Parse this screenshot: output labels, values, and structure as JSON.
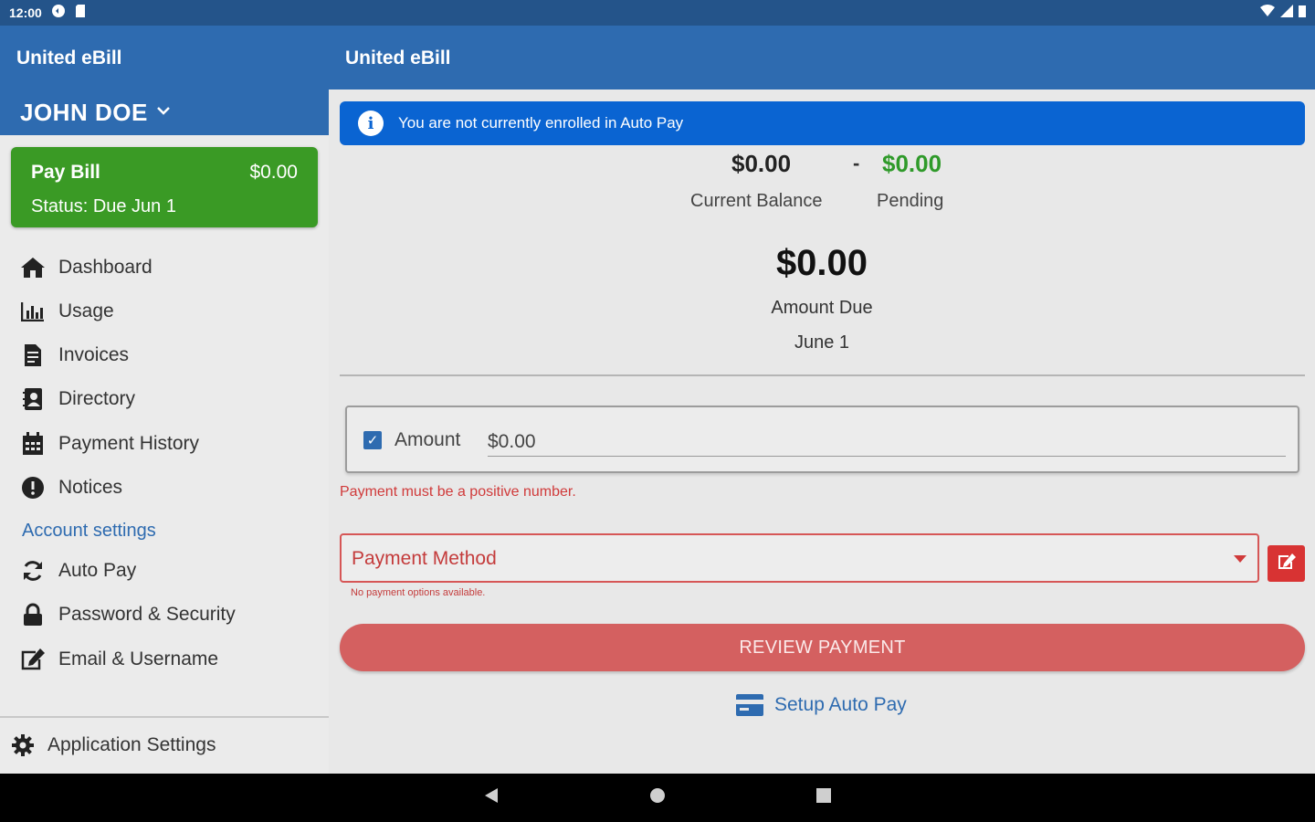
{
  "status_bar": {
    "time": "12:00"
  },
  "app_bar": {
    "title_left": "United eBill",
    "title_main": "United eBill"
  },
  "sidebar": {
    "user_name": "JOHN DOE",
    "pay_bill": {
      "title": "Pay Bill",
      "amount": "$0.00",
      "status": "Status: Due Jun 1"
    },
    "items": [
      {
        "label": "Dashboard",
        "icon": "home-icon"
      },
      {
        "label": "Usage",
        "icon": "bar-chart-icon"
      },
      {
        "label": "Invoices",
        "icon": "invoice-icon"
      },
      {
        "label": "Directory",
        "icon": "contact-book-icon"
      },
      {
        "label": "Payment History",
        "icon": "calendar-icon"
      },
      {
        "label": "Notices",
        "icon": "alert-circle-icon"
      }
    ],
    "account_settings_label": "Account settings",
    "account_items": [
      {
        "label": "Auto Pay",
        "icon": "sync-icon"
      },
      {
        "label": "Password & Security",
        "icon": "lock-icon"
      },
      {
        "label": "Email & Username",
        "icon": "edit-icon"
      }
    ],
    "app_settings_label": "Application Settings"
  },
  "main": {
    "banner_text": "You are not currently enrolled in Auto Pay",
    "current_balance": {
      "value": "$0.00",
      "label": "Current Balance"
    },
    "separator": "-",
    "pending": {
      "value": "$0.00",
      "label": "Pending"
    },
    "amount_due": {
      "value": "$0.00",
      "label": "Amount Due",
      "date": "June 1"
    },
    "amount_field": {
      "label": "Amount",
      "value": "$0.00",
      "checked": true
    },
    "amount_error": "Payment must be a positive number.",
    "payment_method": {
      "placeholder": "Payment Method",
      "error": "No payment options available."
    },
    "review_button": "REVIEW PAYMENT",
    "setup_auto_pay": "Setup Auto Pay"
  },
  "colors": {
    "app_bar": "#2e6bb0",
    "status_bar": "#24548a",
    "pay_bill_green": "#3a9a25",
    "banner_blue": "#0a64d2",
    "pending_green": "#2f9a2a",
    "error_red": "#d03a3a",
    "review_button": "#d46060"
  }
}
